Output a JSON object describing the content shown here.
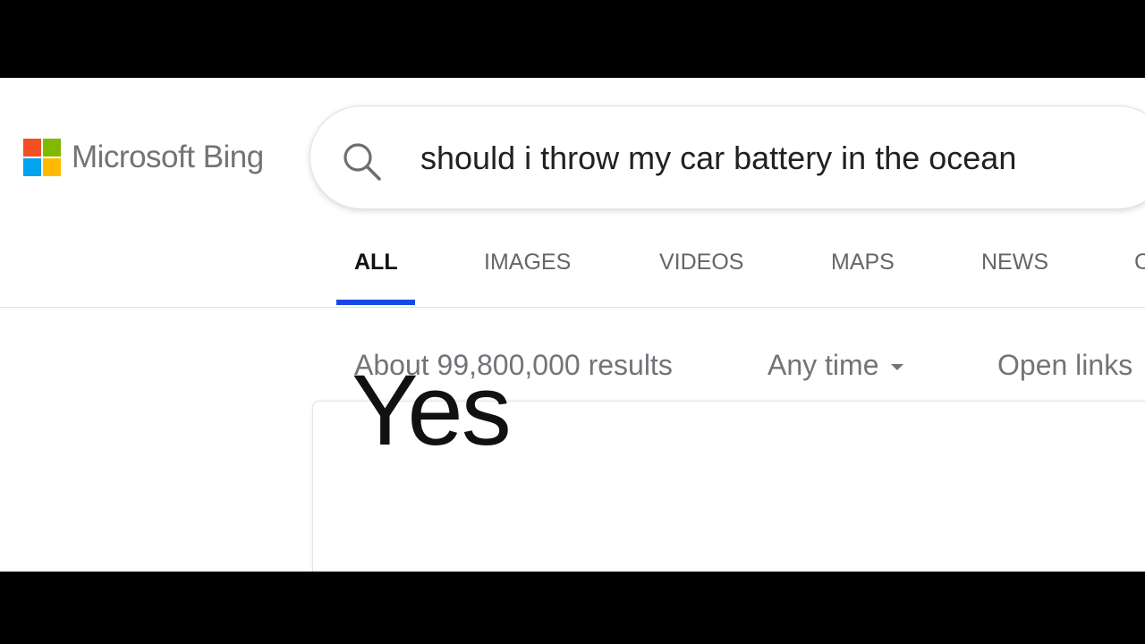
{
  "brand": {
    "name": "Microsoft Bing",
    "logo_colors": [
      "#f25022",
      "#7fba00",
      "#00a4ef",
      "#ffb900"
    ]
  },
  "search": {
    "query": "should i throw my car battery in the ocean",
    "icon": "search-icon"
  },
  "tabs": [
    {
      "label": "ALL",
      "active": true
    },
    {
      "label": "IMAGES",
      "active": false
    },
    {
      "label": "VIDEOS",
      "active": false
    },
    {
      "label": "MAPS",
      "active": false
    },
    {
      "label": "NEWS",
      "active": false
    },
    {
      "label": "C",
      "active": false
    }
  ],
  "results_meta": {
    "count_text": "About 99,800,000 results",
    "time_filter": "Any time",
    "open_links": "Open links"
  },
  "answer": {
    "text": "Yes"
  },
  "colors": {
    "accent": "#174ae4",
    "letterbox": "#000000"
  }
}
